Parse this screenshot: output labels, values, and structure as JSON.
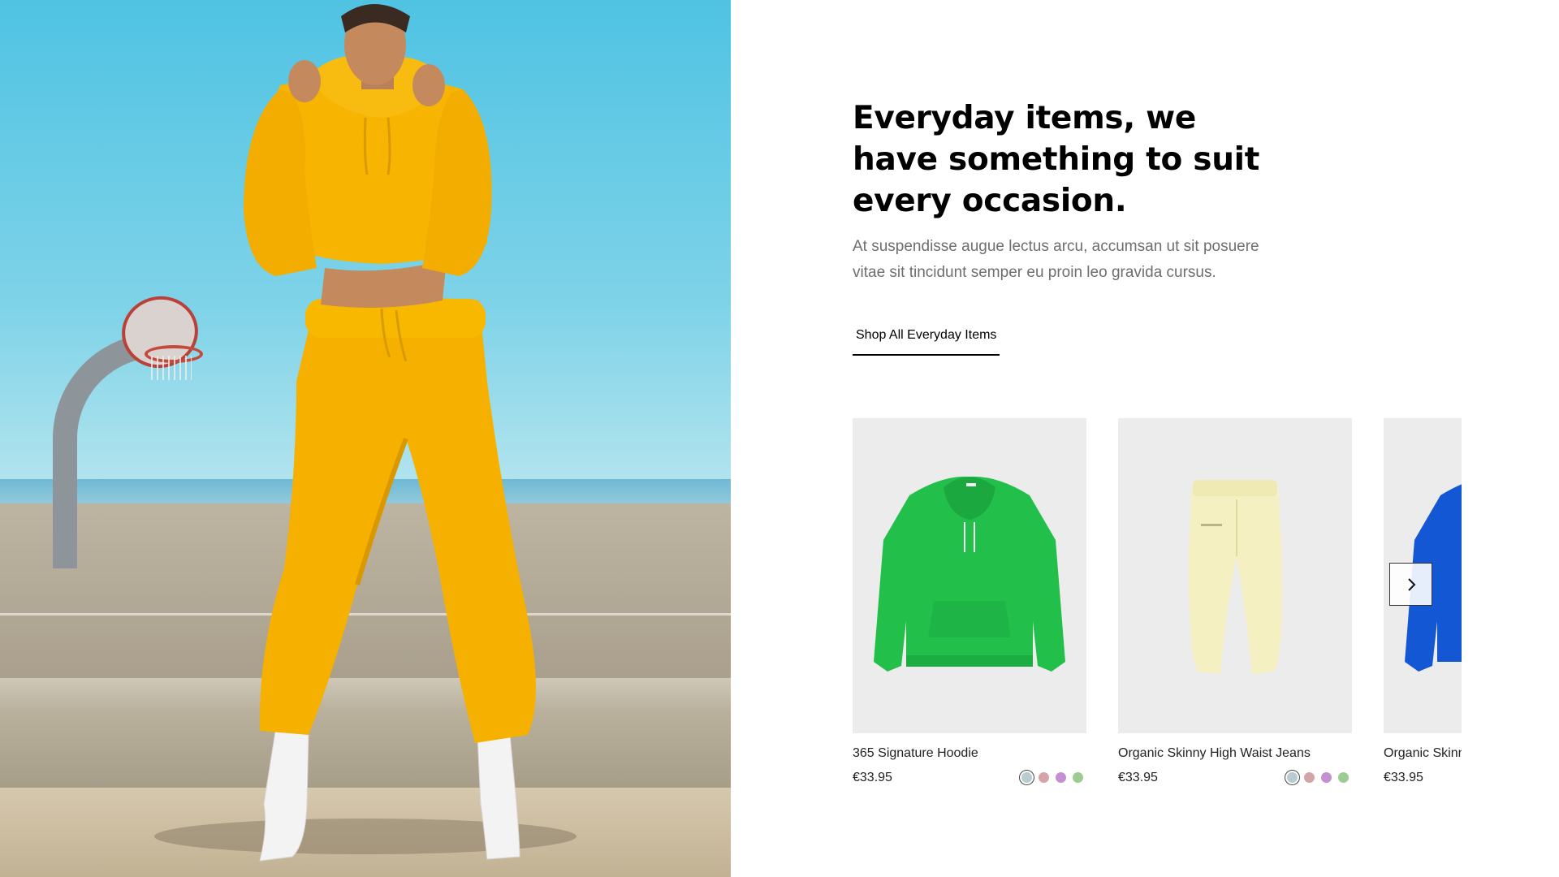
{
  "hero": {
    "image": "woman-in-yellow-tracksuit-photo",
    "colors": {
      "sky": "#4fc3e3",
      "outfit": "#f5b100",
      "boots": "#f2f2f2"
    }
  },
  "intro": {
    "headline": "Everyday items, we have something to suit every occasion.",
    "body": "At suspendisse augue lectus arcu, accumsan ut sit posuere vitae sit tincidunt semper eu proin leo gravida cursus.",
    "cta_label": "Shop All Everyday Items"
  },
  "products": [
    {
      "name": "365 Signature Hoodie",
      "price": "€33.95",
      "image": "green-hoodie",
      "image_color": "#22c04a",
      "swatches": [
        "#b7cbd0",
        "#d3a5a8",
        "#c68fd2",
        "#9dcc93"
      ],
      "selected_swatch": 0
    },
    {
      "name": "Organic Skinny High Waist Jeans",
      "price": "€33.95",
      "image": "pale-yellow-sweatpants",
      "image_color": "#f4f0c2",
      "swatches": [
        "#b7cbd0",
        "#d3a5a8",
        "#c68fd2",
        "#9dcc93"
      ],
      "selected_swatch": 0
    },
    {
      "name": "Organic Skinny High Waist Jeans",
      "price": "€33.95",
      "image": "blue-hoodie",
      "image_color": "#1357d4",
      "swatches": [
        "#b7cbd0",
        "#d3a5a8",
        "#c68fd2",
        "#9dcc93"
      ],
      "selected_swatch": 0
    }
  ],
  "carousel": {
    "next_icon": "chevron-right-icon"
  }
}
